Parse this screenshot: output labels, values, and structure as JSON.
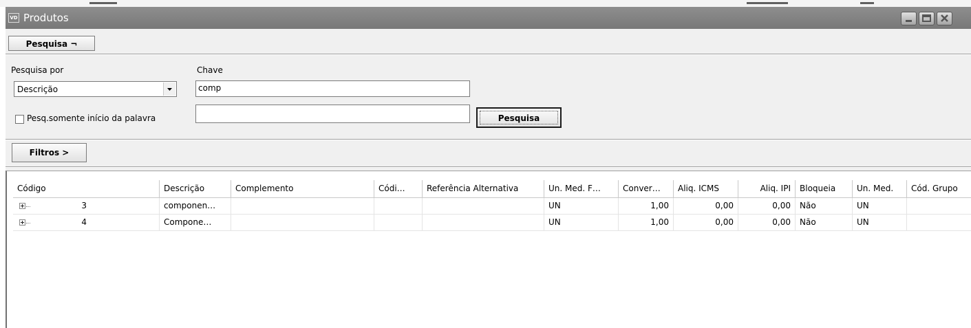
{
  "window": {
    "title": "Produtos",
    "icon": "VD"
  },
  "toolbar": {
    "pesquisa_toggle": "Pesquisa ¬",
    "filtros_toggle": "Filtros >"
  },
  "search": {
    "pesquisa_por_label": "Pesquisa por",
    "pesquisa_por_value": "Descrição",
    "chave_label": "Chave",
    "chave_value": "comp",
    "second_value": "",
    "checkbox_label": "Pesq.somente início da palavra",
    "checkbox_checked": false,
    "search_button": "Pesquisa"
  },
  "grid": {
    "columns": [
      "Código",
      "Descrição",
      "Complemento",
      "Códi…",
      "Referência Alternativa",
      "Un. Med. F…",
      "Conver…",
      "Aliq. ICMS",
      "Aliq. IPI",
      "Bloqueia",
      "Un. Med.",
      "Cód. Grupo"
    ],
    "rows": [
      {
        "codigo": "3",
        "descricao": "componen…",
        "complemento": "",
        "codi": "",
        "referencia": "",
        "unmedf": "UN",
        "conver": "1,00",
        "icms": "0,00",
        "ipi": "0,00",
        "bloqueia": "Não",
        "unmed": "UN",
        "grupo": ""
      },
      {
        "codigo": "4",
        "descricao": "Compone…",
        "complemento": "",
        "codi": "",
        "referencia": "",
        "unmedf": "UN",
        "conver": "1,00",
        "icms": "0,00",
        "ipi": "0,00",
        "bloqueia": "Não",
        "unmed": "UN",
        "grupo": ""
      }
    ]
  },
  "colors": {
    "titlebar": "#808080",
    "panel": "#f0f0f0",
    "grid_bg": "#ffffff"
  }
}
